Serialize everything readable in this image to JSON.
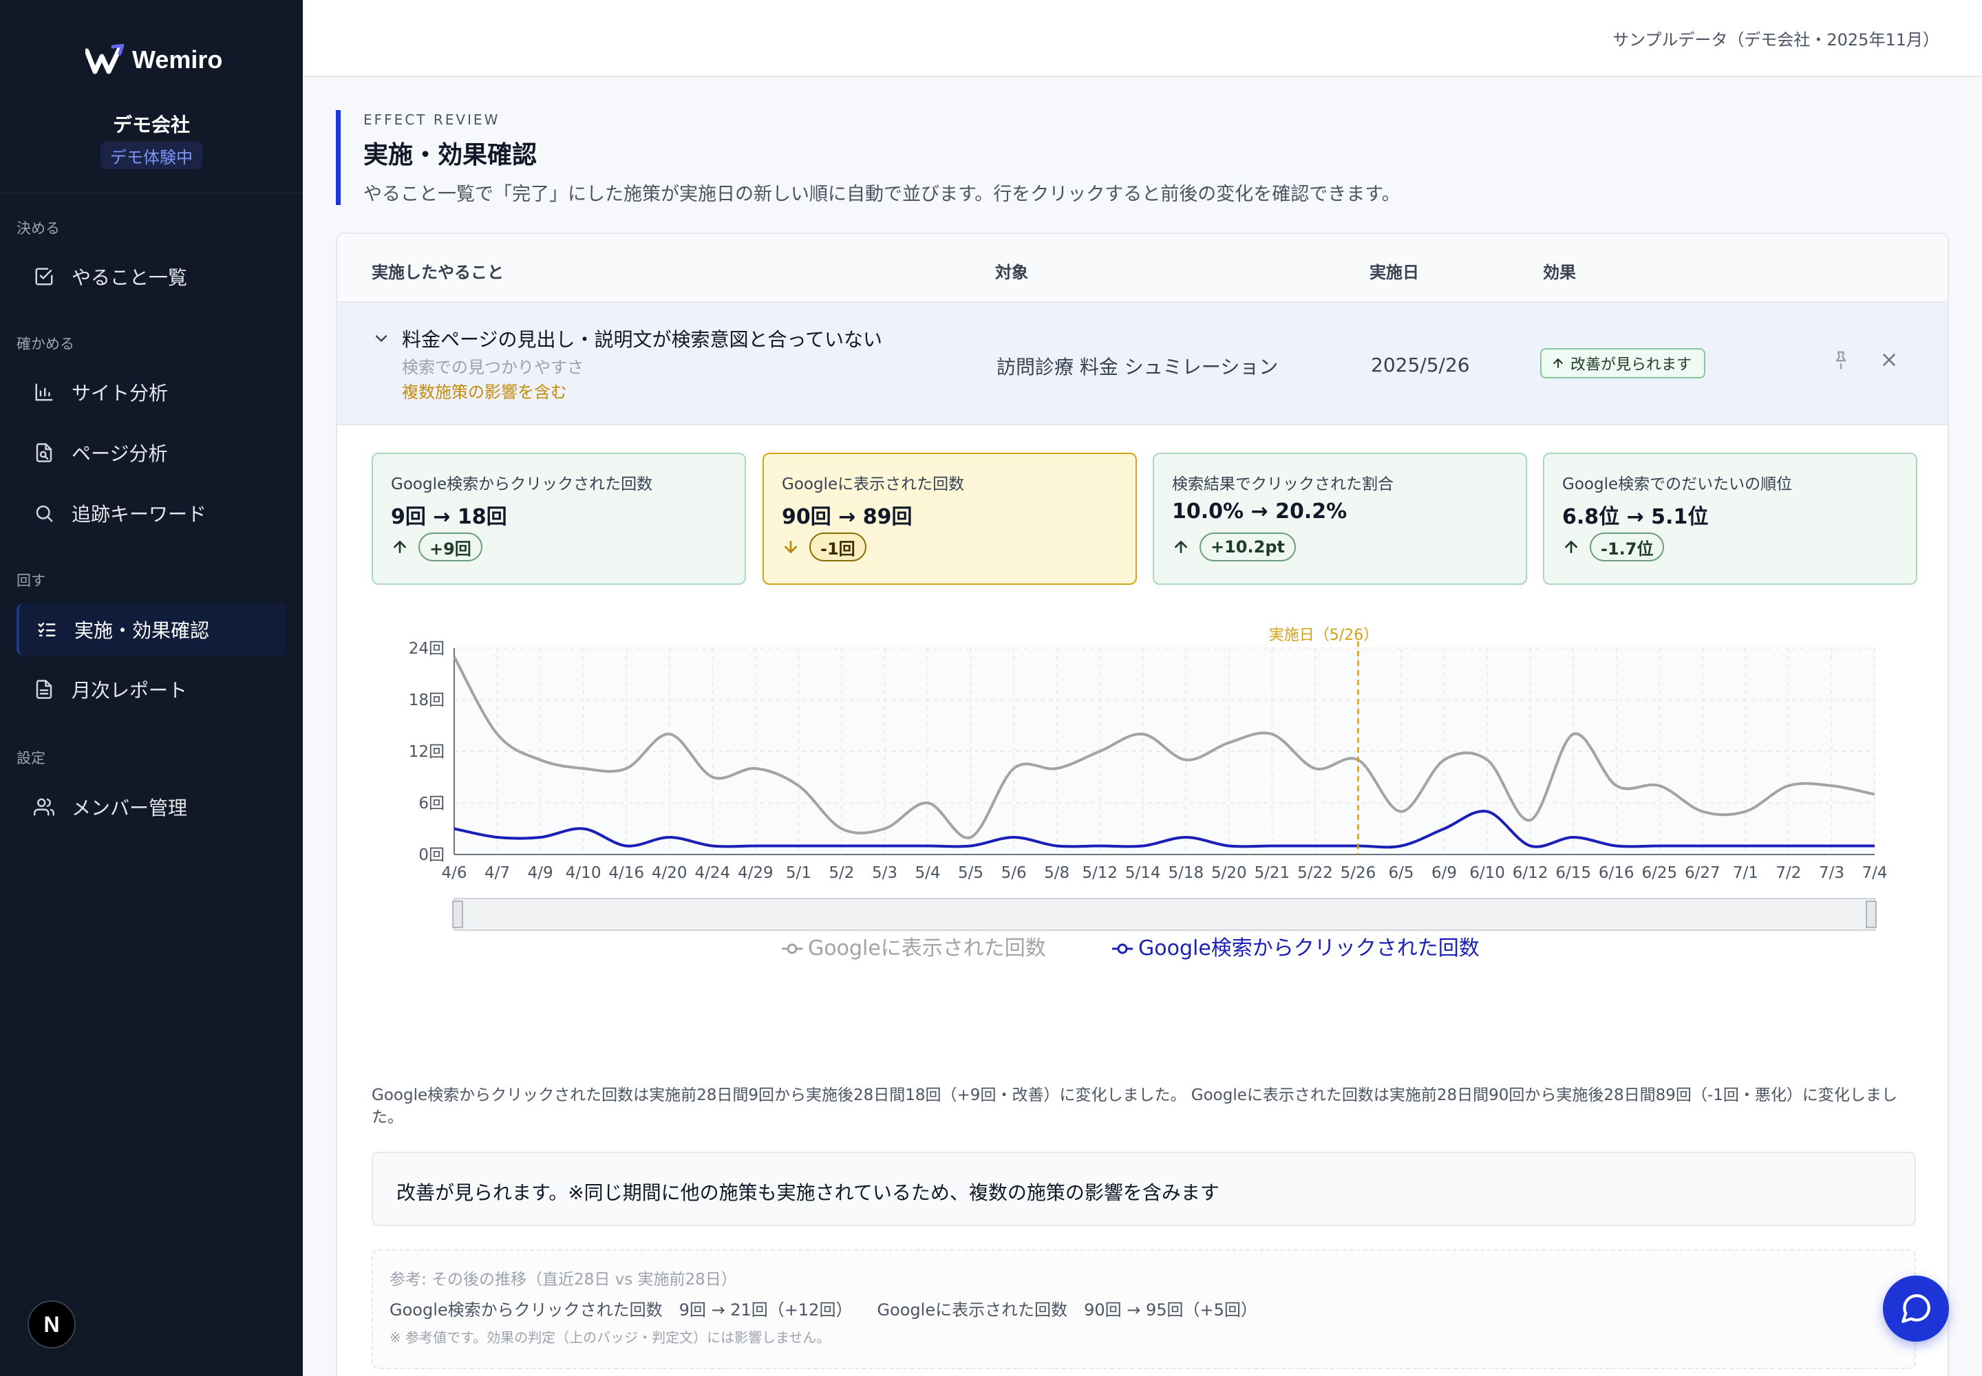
{
  "sidebar": {
    "brand": "Wemiro",
    "company": "デモ会社",
    "demo_badge": "デモ体験中",
    "sections": {
      "decide": "決める",
      "verify": "確かめる",
      "cycle": "回す",
      "settings": "設定"
    },
    "items": [
      {
        "label": "やること一覧",
        "icon": "checkbox-icon"
      },
      {
        "label": "サイト分析",
        "icon": "bar-chart-icon"
      },
      {
        "label": "ページ分析",
        "icon": "file-search-icon"
      },
      {
        "label": "追跡キーワード",
        "icon": "search-icon"
      },
      {
        "label": "実施・効果確認",
        "icon": "list-checks-icon",
        "active": true
      },
      {
        "label": "月次レポート",
        "icon": "file-text-icon"
      },
      {
        "label": "メンバー管理",
        "icon": "users-icon"
      }
    ],
    "bottom_button": "N"
  },
  "topbar": {
    "note": "サンプルデータ（デモ会社・2025年11月）"
  },
  "header": {
    "eyebrow": "EFFECT REVIEW",
    "title": "実施・効果確認",
    "description": "やること一覧で「完了」にした施策が実施日の新しい順に自動で並びます。行をクリックすると前後の変化を確認できます。"
  },
  "table": {
    "columns": [
      "実施したやること",
      "対象",
      "実施日",
      "効果"
    ],
    "row": {
      "title": "料金ページの見出し・説明文が検索意図と合っていない",
      "category": "検索での見つかりやすさ",
      "note": "複数施策の影響を含む",
      "target": "訪問診療 料金 シュミレーション",
      "date": "2025/5/26",
      "effect": "改善が見られます"
    }
  },
  "metrics": [
    {
      "label": "Google検索からクリックされた回数",
      "value": "9回 → 18回",
      "delta": "+9回",
      "direction": "up",
      "status": "good"
    },
    {
      "label": "Googleに表示された回数",
      "value": "90回 → 89回",
      "delta": "-1回",
      "direction": "down",
      "status": "warn"
    },
    {
      "label": "検索結果でクリックされた割合",
      "value": "10.0% → 20.2%",
      "delta": "+10.2pt",
      "direction": "up",
      "status": "good"
    },
    {
      "label": "Google検索でのだいたいの順位",
      "value": "6.8位 → 5.1位",
      "delta": "-1.7位",
      "direction": "up",
      "status": "good"
    }
  ],
  "chart_data": {
    "type": "line",
    "categories": [
      "4/6",
      "4/7",
      "4/9",
      "4/10",
      "4/16",
      "4/20",
      "4/24",
      "4/29",
      "5/1",
      "5/2",
      "5/3",
      "5/4",
      "5/5",
      "5/6",
      "5/8",
      "5/12",
      "5/14",
      "5/18",
      "5/20",
      "5/21",
      "5/22",
      "5/26",
      "6/5",
      "6/9",
      "6/10",
      "6/12",
      "6/15",
      "6/16",
      "6/25",
      "6/27",
      "7/1",
      "7/2",
      "7/3",
      "7/4"
    ],
    "series": [
      {
        "name": "Googleに表示された回数",
        "color": "#a3a3a3",
        "values": [
          23,
          14,
          11,
          10,
          10,
          14,
          9,
          10,
          8,
          3,
          3,
          6,
          2,
          10,
          10,
          12,
          14,
          11,
          13,
          14,
          10,
          11,
          5,
          11,
          11,
          4,
          14,
          8,
          8,
          5,
          5,
          8,
          8,
          7
        ]
      },
      {
        "name": "Google検索からクリックされた回数",
        "color": "#1a1fb8",
        "values": [
          3,
          2,
          2,
          3,
          1,
          2,
          1,
          1,
          1,
          1,
          1,
          1,
          1,
          2,
          1,
          1,
          1,
          2,
          1,
          1,
          1,
          1,
          1,
          3,
          5,
          1,
          2,
          1,
          1,
          1,
          1,
          1,
          1,
          1
        ]
      }
    ],
    "ylim": [
      0,
      24
    ],
    "yticks": [
      "0回",
      "6回",
      "12回",
      "18回",
      "24回"
    ],
    "marker": {
      "category": "5/26",
      "label": "実施日（5/26）",
      "color": "#d4a017"
    },
    "grid": true,
    "legend": "bottom-center"
  },
  "summary": "Google検索からクリックされた回数は実施前28日間9回から実施後28日間18回（+9回・改善）に変化しました。 Googleに表示された回数は実施前28日間90回から実施後28日間89回（-1回・悪化）に変化しました。",
  "verdict": "改善が見られます。※同じ期間に他の施策も実施されているため、複数の施策の影響を含みます",
  "reference": {
    "title": "参考: その後の推移（直近28日 vs 実施前28日）",
    "line": "Google検索からクリックされた回数　9回 → 21回（+12回）　　Googleに表示された回数　90回 → 95回（+5回）",
    "footnote": "※ 参考値です。効果の判定（上のバッジ・判定文）には影響しません。"
  }
}
